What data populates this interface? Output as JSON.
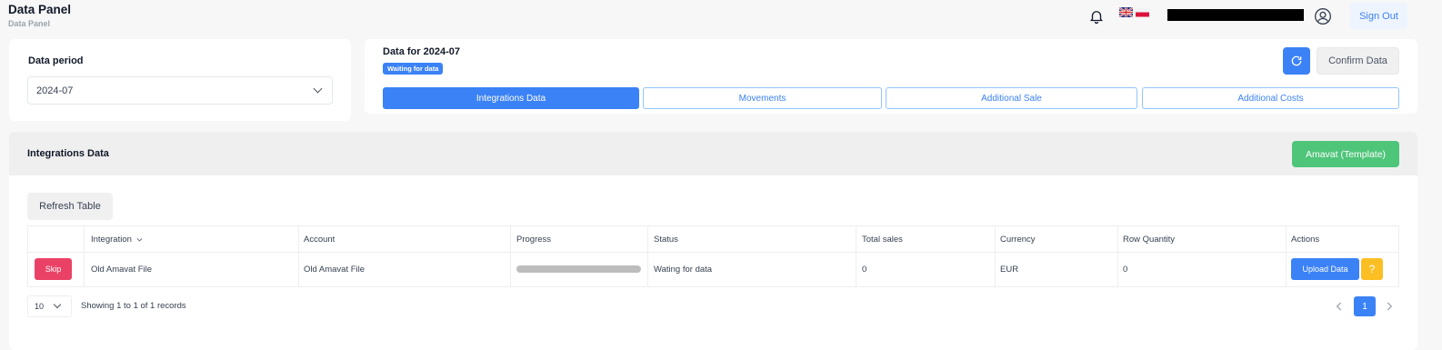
{
  "header": {
    "title": "Data Panel",
    "subtitle": "Data Panel",
    "sign_out": "Sign Out"
  },
  "period": {
    "label": "Data period",
    "value": "2024-07"
  },
  "data_card": {
    "title": "Data for 2024-07",
    "badge": "Waiting for data",
    "confirm": "Confirm Data"
  },
  "tabs": [
    {
      "label": "Integrations Data",
      "active": true
    },
    {
      "label": "Movements"
    },
    {
      "label": "Additional Sale"
    },
    {
      "label": "Additional Costs"
    }
  ],
  "section": {
    "title": "Integrations Data",
    "template_button": "Amavat (Template)",
    "refresh_table": "Refresh Table"
  },
  "table": {
    "columns": [
      "Integration",
      "Account",
      "Progress",
      "Status",
      "Total sales",
      "Currency",
      "Row Quantity",
      "Actions"
    ],
    "rows": [
      {
        "skip": "Skip",
        "integration": "Old Amavat File",
        "account": "Old Amavat File",
        "progress": 0,
        "status": "Wating for data",
        "total_sales": "0",
        "currency": "EUR",
        "row_quantity": "0",
        "upload": "Upload Data",
        "help": "?"
      }
    ]
  },
  "pagination": {
    "page_size": "10",
    "records": "Showing 1 to 1 of 1 records",
    "current_page": "1"
  },
  "colors": {
    "accent": "#3b82f6",
    "success": "#4fc57a",
    "danger": "#ea4266",
    "warning": "#fbbf24"
  }
}
